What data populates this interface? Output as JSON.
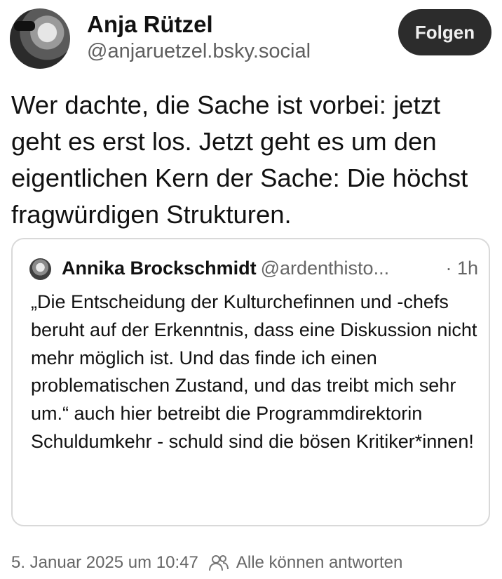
{
  "author": {
    "display_name": "Anja Rützel",
    "handle": "@anjaruetzel.bsky.social"
  },
  "follow_button": {
    "label": "Folgen"
  },
  "post": {
    "text": "Wer dachte, die Sache ist vorbei: jetzt geht es erst los. Jetzt geht es um den eigentlichen Kern der Sache: Die höchst fragwürdigen Strukturen."
  },
  "quote": {
    "display_name": "Annika Brockschmidt",
    "handle": "@ardenthisto...",
    "time": "· 1h",
    "text": "„Die Entscheidung der Kulturchefinnen und -chefs beruht auf der Erkenntnis, dass eine Diskussion nicht mehr möglich ist. Und das finde ich einen problematischen Zustand, und das treibt mich sehr um.“ auch hier betreibt die Programmdirektorin Schuldumkehr - schuld sind die bösen Kritiker*innen!"
  },
  "footer": {
    "timestamp": "5. Januar 2025 um 10:47",
    "reply_setting": "Alle können antworten",
    "reply_icon": "people-icon"
  },
  "colors": {
    "follow_button_bg": "#2c2c2c",
    "secondary_text": "#666666",
    "card_border": "#d9d9d9"
  }
}
